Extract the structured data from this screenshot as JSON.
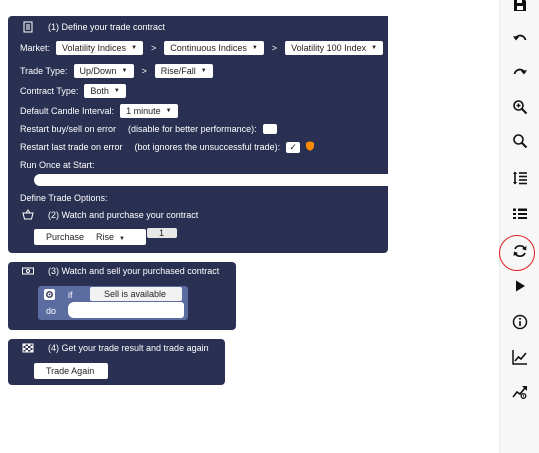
{
  "block1": {
    "title": "(1) Define your trade contract",
    "market_label": "Market:",
    "market": [
      "Volatility Indices",
      "Continuous Indices",
      "Volatility 100 Index"
    ],
    "trade_type_label": "Trade Type:",
    "trade_type": [
      "Up/Down",
      "Rise/Fall"
    ],
    "contract_type_label": "Contract Type:",
    "contract_type": "Both",
    "candle_label": "Default Candle Interval:",
    "candle": "1 minute",
    "restart_error_label": "Restart buy/sell on error",
    "restart_error_note": "(disable for better performance):",
    "restart_last_label": "Restart last trade on error",
    "restart_last_note": "(bot ignores the unsuccessful trade):",
    "run_once_label": "Run Once at Start:",
    "trade_options_label": "Define Trade Options:"
  },
  "block2": {
    "title": "(2) Watch and purchase your contract",
    "purchase_label": "Purchase",
    "purchase_value": "Rise",
    "number": "1"
  },
  "block3": {
    "title": "(3) Watch and sell your purchased contract",
    "if_label": "if",
    "condition": "Sell is available",
    "do_label": "do"
  },
  "block4": {
    "title": "(4) Get your trade result and trade again",
    "trade_again": "Trade Again"
  },
  "toolbar": {
    "icons": [
      "save-icon",
      "undo-icon",
      "redo-icon",
      "zoom-in-icon",
      "zoom-out-icon",
      "rearrange-icon",
      "logs-icon",
      "reset-icon",
      "run-icon",
      "info-icon",
      "chart-icon",
      "trading-view-icon"
    ],
    "highlighted": "reset-icon"
  },
  "colors": {
    "block": "#2a3052",
    "highlight": "#e41e1e",
    "orange": "#ff8c00"
  }
}
